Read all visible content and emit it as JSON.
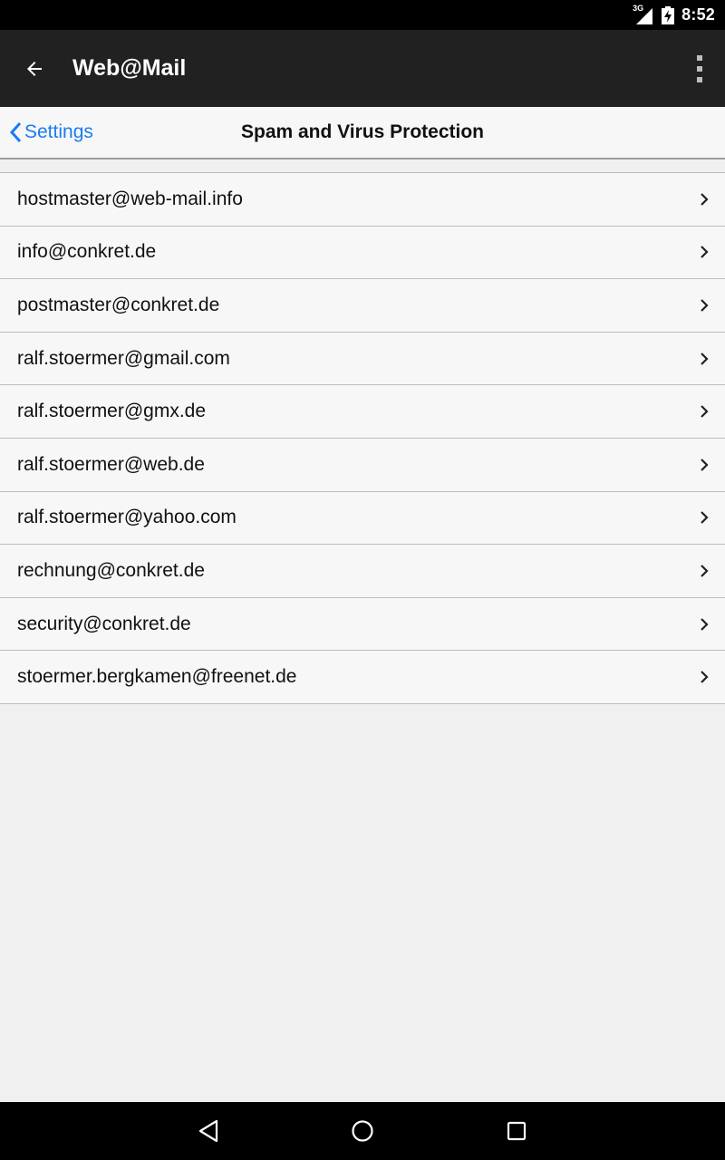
{
  "status_bar": {
    "network": "3G",
    "time": "8:52"
  },
  "app_bar": {
    "title": "Web@Mail",
    "back_icon": "arrow-back-icon",
    "menu_icon": "overflow-menu-icon"
  },
  "nav_bar": {
    "back_label": "Settings",
    "title": "Spam and Virus Protection"
  },
  "accounts": [
    {
      "label": "hostmaster@web-mail.info"
    },
    {
      "label": "info@conkret.de"
    },
    {
      "label": "postmaster@conkret.de"
    },
    {
      "label": "ralf.stoermer@gmail.com"
    },
    {
      "label": "ralf.stoermer@gmx.de"
    },
    {
      "label": "ralf.stoermer@web.de"
    },
    {
      "label": "ralf.stoermer@yahoo.com"
    },
    {
      "label": "rechnung@conkret.de"
    },
    {
      "label": "security@conkret.de"
    },
    {
      "label": "stoermer.bergkamen@freenet.de"
    }
  ],
  "system_nav": {
    "back": "back-triangle-icon",
    "home": "home-circle-icon",
    "recents": "recents-square-icon"
  },
  "colors": {
    "accent": "#1a7cf0",
    "app_bar": "#212121",
    "background": "#eff0ef"
  }
}
